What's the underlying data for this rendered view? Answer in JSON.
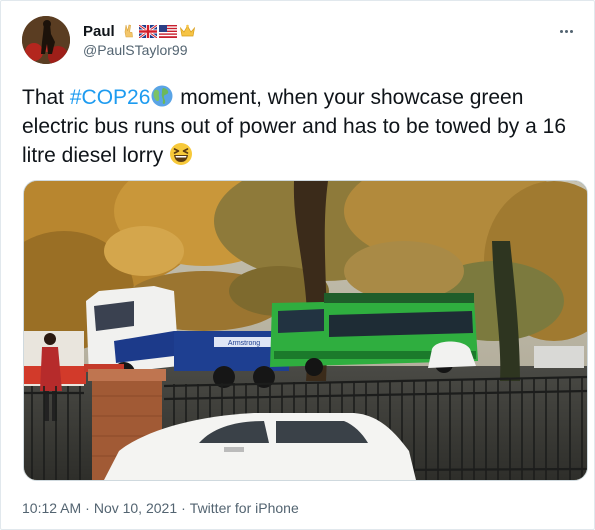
{
  "author": {
    "display_name": "Paul",
    "handle": "@PaulSTaylor99",
    "name_emojis": [
      "victory-hand-emoji",
      "uk-flag-emoji",
      "us-flag-emoji",
      "crown-emoji"
    ]
  },
  "tweet": {
    "text_parts": {
      "prefix": "That ",
      "hashtag": "#COP26",
      "hashtag_emoji": "globe-emoji",
      "body": " moment, when your showcase green electric bus runs out of power and has to be towed by a 16 litre diesel lorry ",
      "end_emoji": "grinning-squinting-face-emoji"
    },
    "media": {
      "kind": "photo",
      "signage_text": "Armstrong"
    }
  },
  "meta": {
    "time": "10:12 AM",
    "sep1": "·",
    "date": "Nov 10, 2021",
    "sep2": "·",
    "source": "Twitter for iPhone"
  },
  "colors": {
    "link": "#1d9bf0",
    "text": "#0f1419",
    "secondary": "#536471",
    "bus_green": "#2fae3f"
  }
}
